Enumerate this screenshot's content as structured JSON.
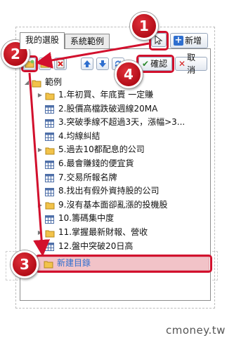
{
  "tabs": [
    {
      "label": "我的選股",
      "active": true
    },
    {
      "label": "系統範例",
      "active": false
    }
  ],
  "toolbar": {
    "add_label": "新增",
    "confirm_label": "確認",
    "cancel_label": "取消"
  },
  "tree": {
    "root_label": "範例",
    "items": [
      {
        "label": "1.年初買、年底賣 一定賺",
        "icon": "folder-icon",
        "expander": true
      },
      {
        "label": "2.股價高檔跌破週線20MA",
        "icon": "grid-icon",
        "expander": false
      },
      {
        "label": "3.突破季線不超過3天，漲幅>3...",
        "icon": "grid-icon",
        "expander": false
      },
      {
        "label": "4.均線糾結",
        "icon": "grid-icon",
        "expander": false
      },
      {
        "label": "5.過去10都配息的公司",
        "icon": "folder-icon",
        "expander": true
      },
      {
        "label": "6.最會賺錢的便宜貨",
        "icon": "grid-icon",
        "expander": false
      },
      {
        "label": "7.交易所報名牌",
        "icon": "grid-icon",
        "expander": false
      },
      {
        "label": "8.找出有假外資持股的公司",
        "icon": "grid-icon",
        "expander": false
      },
      {
        "label": "9.沒有基本面卻亂漲的投機股",
        "icon": "folder-icon",
        "expander": true
      },
      {
        "label": "10.籌碼集中度",
        "icon": "grid-icon",
        "expander": false
      },
      {
        "label": "11.掌握最新財報、營收",
        "icon": "folder-icon",
        "expander": true
      },
      {
        "label": "12.盤中突破20日高",
        "icon": "grid-icon",
        "expander": false
      }
    ],
    "new_folder_label": "新建目錄"
  },
  "badges": [
    "1",
    "2",
    "3",
    "4"
  ],
  "watermark": "cmoney.tw",
  "colors": {
    "highlight": "#d2102d",
    "folder": "#f2c34a",
    "grid_icon": "#4e6fa8",
    "accent_blue": "#2f6fcf",
    "accent_red": "#d62121"
  }
}
